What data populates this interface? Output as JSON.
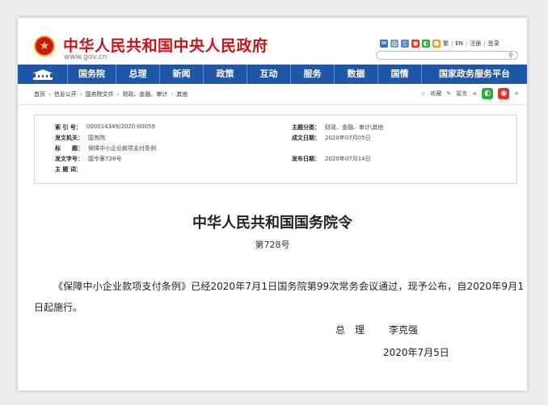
{
  "header": {
    "site_title": "中华人民共和国中央人民政府",
    "site_url": "www.gov.cn",
    "links": [
      "繁",
      "EN",
      "注册",
      "登录"
    ]
  },
  "nav": {
    "items": [
      "国务院",
      "总理",
      "新闻",
      "政策",
      "互动",
      "服务",
      "数据",
      "国情",
      "国家政务服务平台"
    ]
  },
  "breadcrumb": [
    "首页",
    "信息公开",
    "国务院文件",
    "财政、金融、审计",
    "其他"
  ],
  "tools": {
    "favorite": "收藏",
    "note": "留言"
  },
  "info": {
    "index_label": "索 引 号：",
    "index_value": "000014349/2020-00059",
    "category_label": "主题分类：",
    "category_value": "财政、金融、审计\\其他",
    "issuer_label": "发文机关：",
    "issuer_value": "国务院",
    "written_label": "成文日期：",
    "written_value": "2020年07月05日",
    "title_label": "标　　题：",
    "title_value": "保障中小企业款项支付条例",
    "doc_no_label": "发文字号：",
    "doc_no_value": "国令第728号",
    "published_label": "发布日期：",
    "published_value": "2020年07月14日",
    "keywords_label": "主 题 词：",
    "keywords_value": ""
  },
  "document": {
    "title": "中华人民共和国国务院令",
    "number": "第728号",
    "body": "《保障中小企业款项支付条例》已经2020年7月1日国务院第99次常务会议通过，现予公布，自2020年9月1日起施行。",
    "sign_role": "总　理",
    "sign_name": "李克强",
    "date": "2020年7月5日"
  },
  "colors": {
    "brand_red": "#c8161d",
    "nav_blue": "#1f56a8"
  }
}
